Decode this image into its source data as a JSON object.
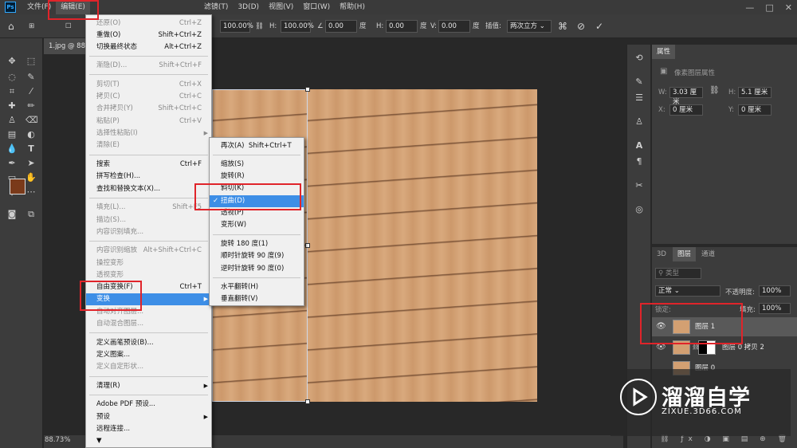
{
  "menubar": {
    "logo": "Ps",
    "items": [
      "文件(F)",
      "编辑(E)",
      "",
      "",
      "",
      "",
      "",
      "",
      "",
      "滤镜(T)",
      "3D(D)",
      "视图(V)",
      "窗口(W)",
      "帮助(H)"
    ],
    "window_controls": [
      "—",
      "□",
      "✕"
    ]
  },
  "options_bar": {
    "w_value": "100.00%",
    "h_label": "H:",
    "h_value": "100.00%",
    "angle_value": "0.00",
    "degree_unit": "度",
    "hskew_label": "H:",
    "hskew_value": "0.00",
    "vskew_label": "V:",
    "vskew_value": "0.00",
    "interp_label": "插值:",
    "interp_value": "两次立方"
  },
  "document": {
    "tab_title": "1.jpg @ 88...",
    "zoom": "88.73%"
  },
  "edit_menu": {
    "items": [
      {
        "label": "还原(O)",
        "shortcut": "Ctrl+Z",
        "disabled": true
      },
      {
        "label": "重做(O)",
        "shortcut": "Shift+Ctrl+Z"
      },
      {
        "label": "切换最终状态",
        "shortcut": "Alt+Ctrl+Z"
      },
      {
        "label": "渐隐(D)...",
        "shortcut": "Shift+Ctrl+F",
        "disabled": true
      },
      {
        "label": "剪切(T)",
        "shortcut": "Ctrl+X",
        "disabled": true
      },
      {
        "label": "拷贝(C)",
        "shortcut": "Ctrl+C",
        "disabled": true
      },
      {
        "label": "合并拷贝(Y)",
        "shortcut": "Shift+Ctrl+C",
        "disabled": true
      },
      {
        "label": "粘贴(P)",
        "shortcut": "Ctrl+V",
        "disabled": true
      },
      {
        "label": "选择性粘贴(I)",
        "shortcut": "",
        "disabled": true,
        "submenu": true
      },
      {
        "label": "清除(E)",
        "shortcut": "",
        "disabled": true
      },
      {
        "label": "搜索",
        "shortcut": "Ctrl+F"
      },
      {
        "label": "拼写检查(H)...",
        "shortcut": ""
      },
      {
        "label": "查找和替换文本(X)...",
        "shortcut": ""
      },
      {
        "label": "填充(L)...",
        "shortcut": "Shift+F5",
        "disabled": true
      },
      {
        "label": "描边(S)...",
        "shortcut": "",
        "disabled": true
      },
      {
        "label": "内容识别填充...",
        "shortcut": "",
        "disabled": true
      },
      {
        "label": "内容识别缩放",
        "shortcut": "Alt+Shift+Ctrl+C",
        "disabled": true
      },
      {
        "label": "操控变形",
        "shortcut": "",
        "disabled": true
      },
      {
        "label": "透视变形",
        "shortcut": "",
        "disabled": true
      },
      {
        "label": "自由变换(F)",
        "shortcut": "Ctrl+T"
      },
      {
        "label": "变换",
        "shortcut": "",
        "submenu": true,
        "selected": true
      },
      {
        "label": "自动对齐图层...",
        "shortcut": "",
        "disabled": true
      },
      {
        "label": "自动混合图层...",
        "shortcut": "",
        "disabled": true
      },
      {
        "label": "定义画笔预设(B)...",
        "shortcut": ""
      },
      {
        "label": "定义图案...",
        "shortcut": ""
      },
      {
        "label": "定义自定形状...",
        "shortcut": "",
        "disabled": true
      },
      {
        "label": "清理(R)",
        "shortcut": "",
        "submenu": true
      },
      {
        "label": "Adobe PDF 预设...",
        "shortcut": ""
      },
      {
        "label": "预设",
        "shortcut": "",
        "submenu": true
      },
      {
        "label": "远程连接...",
        "shortcut": ""
      },
      {
        "label": "▼",
        "shortcut": ""
      }
    ]
  },
  "transform_submenu": {
    "items": [
      {
        "label": "再次(A)",
        "shortcut": "Shift+Ctrl+T"
      },
      {
        "label": "缩放(S)"
      },
      {
        "label": "旋转(R)"
      },
      {
        "label": "斜切(K)"
      },
      {
        "label": "扭曲(D)",
        "selected": true,
        "check": "✓"
      },
      {
        "label": "透视(P)"
      },
      {
        "label": "变形(W)"
      },
      {
        "label": "旋转 180 度(1)"
      },
      {
        "label": "顺时针旋转 90 度(9)"
      },
      {
        "label": "逆时针旋转 90 度(0)"
      },
      {
        "label": "水平翻转(H)"
      },
      {
        "label": "垂直翻转(V)"
      }
    ]
  },
  "properties_panel": {
    "tab": "属性",
    "subtitle": "像素图层属性",
    "w_label": "W:",
    "w_value": "3.03 厘米",
    "h_label": "H:",
    "h_value": "5.1 厘米",
    "x_label": "X:",
    "x_value": "0 厘米",
    "y_label": "Y:",
    "y_value": "0 厘米"
  },
  "layers_panel": {
    "tabs": [
      "3D",
      "图层",
      "通道"
    ],
    "search_placeholder": "类型",
    "blend_mode": "正常",
    "opacity_label": "不透明度:",
    "opacity_value": "100%",
    "lock_label": "锁定:",
    "fill_label": "填充:",
    "fill_value": "100%",
    "layers": [
      {
        "name": "图层 1",
        "selected": true
      },
      {
        "name": "图层 0 拷贝 2"
      },
      {
        "name": "图层 0"
      }
    ]
  },
  "watermark": {
    "title": "溜溜自学",
    "url": "ZIXUE.3D66.COM"
  }
}
